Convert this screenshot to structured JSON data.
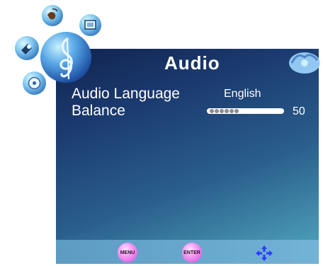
{
  "title": "Audio",
  "rows": [
    {
      "label": "Audio Language",
      "value": "English"
    },
    {
      "label": "Balance",
      "value": "50"
    }
  ],
  "balance": {
    "value": 50,
    "min": 0,
    "max": 100
  },
  "footer": {
    "menu_label": "MENU",
    "enter_label": "ENTER"
  },
  "icons": [
    "music-clef-icon",
    "globe-icon",
    "picture-icon",
    "satellite-icon",
    "disc-icon",
    "flower-icon",
    "navigation-arrows-icon"
  ],
  "colors": {
    "panel_dark": "#11234f",
    "panel_light": "#4a9bb6",
    "footer": "#6aa9d0",
    "button": "#e27ae5",
    "arrows": "#2a3bff"
  }
}
